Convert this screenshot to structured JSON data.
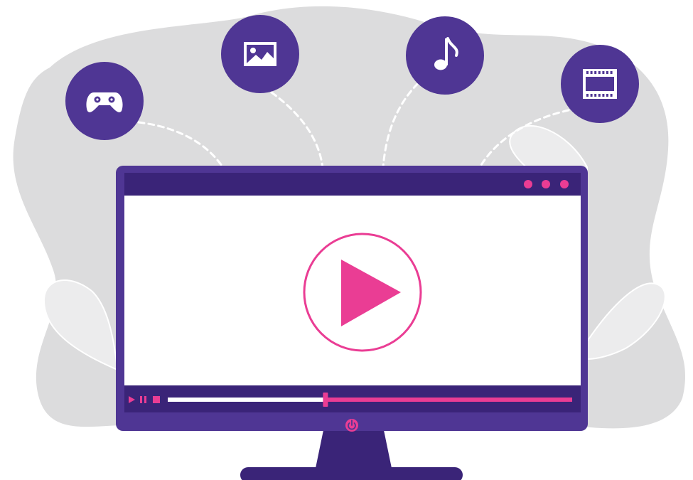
{
  "theme": {
    "backdrop": "#dcdcdd",
    "leaf": "#ececed",
    "monitor_purple": "#4f3694",
    "bar_purple": "#3a2478",
    "accent_pink": "#ea3d94",
    "screen_white": "#ffffff",
    "icon_circle": "#4f3694"
  },
  "media_icons": [
    {
      "name": "gamepad-icon",
      "meaning": "games"
    },
    {
      "name": "image-icon",
      "meaning": "pictures"
    },
    {
      "name": "music-note-icon",
      "meaning": "music"
    },
    {
      "name": "film-icon",
      "meaning": "video"
    }
  ],
  "window_dots": 3,
  "player": {
    "progress": 0.39,
    "controls": [
      "play-icon",
      "pause-icon",
      "stop-icon"
    ]
  }
}
